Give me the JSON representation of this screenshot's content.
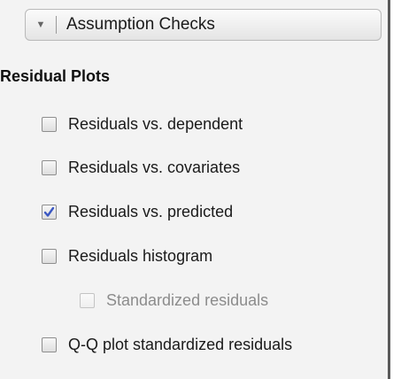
{
  "section": {
    "title": "Assumption Checks",
    "toggle_icon": "triangle-down-icon"
  },
  "residual_plots": {
    "title": "Residual Plots",
    "options": [
      {
        "label": "Residuals vs. dependent",
        "checked": false,
        "enabled": true
      },
      {
        "label": "Residuals vs. covariates",
        "checked": false,
        "enabled": true
      },
      {
        "label": "Residuals vs. predicted",
        "checked": true,
        "enabled": true
      },
      {
        "label": "Residuals histogram",
        "checked": false,
        "enabled": true
      },
      {
        "label": "Standardized residuals",
        "checked": false,
        "enabled": false
      },
      {
        "label": "Q-Q plot standardized residuals",
        "checked": false,
        "enabled": true
      }
    ]
  },
  "colors": {
    "check_mark": "#3a57c2",
    "panel_bg": "#f3f3f3",
    "disabled_text": "#8c8c8c"
  }
}
